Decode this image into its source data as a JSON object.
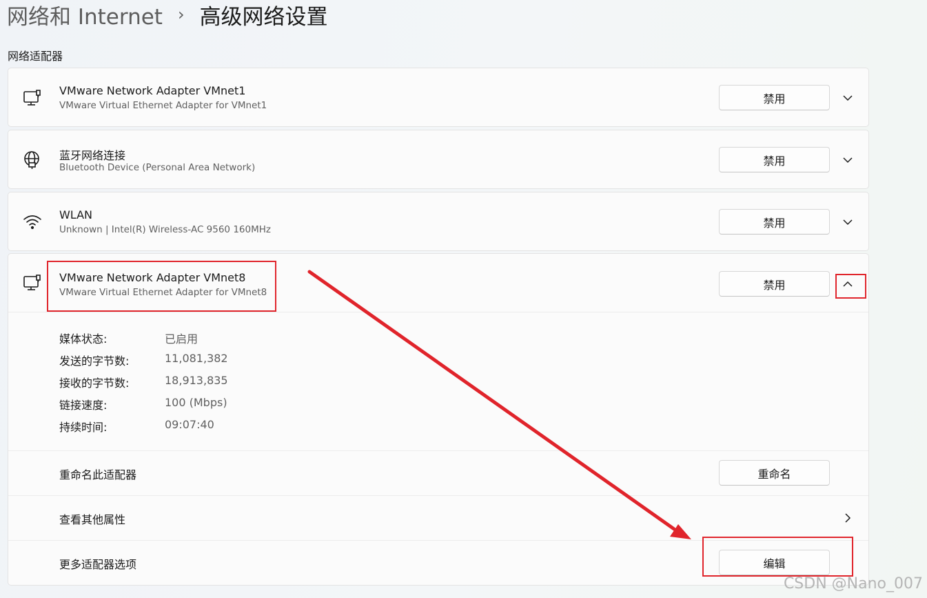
{
  "breadcrumb": {
    "parent": "网络和 Internet",
    "separator": "›",
    "current": "高级网络设置"
  },
  "section_title": "网络适配器",
  "adapters": [
    {
      "name": "VMware Network Adapter VMnet1",
      "description": "VMware Virtual Ethernet Adapter for VMnet1",
      "button": "禁用",
      "icon": "ethernet-pc-icon",
      "expanded": false
    },
    {
      "name": "蓝牙网络连接",
      "description": "Bluetooth Device (Personal Area Network)",
      "button": "禁用",
      "icon": "globe-network-icon",
      "expanded": false
    },
    {
      "name": "WLAN",
      "description": "Unknown | Intel(R) Wireless-AC 9560 160MHz",
      "button": "禁用",
      "icon": "wifi-icon",
      "expanded": false
    },
    {
      "name": "VMware Network Adapter VMnet8",
      "description": "VMware Virtual Ethernet Adapter for VMnet8",
      "button": "禁用",
      "icon": "ethernet-pc-icon",
      "expanded": true
    }
  ],
  "details": [
    {
      "label": "媒体状态:",
      "value": "已启用"
    },
    {
      "label": "发送的字节数:",
      "value": "11,081,382"
    },
    {
      "label": "接收的字节数:",
      "value": "18,913,835"
    },
    {
      "label": "链接速度:",
      "value": "100 (Mbps)"
    },
    {
      "label": "持续时间:",
      "value": "09:07:40"
    }
  ],
  "actions": {
    "rename_label": "重命名此适配器",
    "rename_button": "重命名",
    "properties_label": "查看其他属性",
    "more_label": "更多适配器选项",
    "edit_button": "编辑"
  },
  "annotation_color": "#e0242b",
  "watermark": "CSDN @Nano_007"
}
